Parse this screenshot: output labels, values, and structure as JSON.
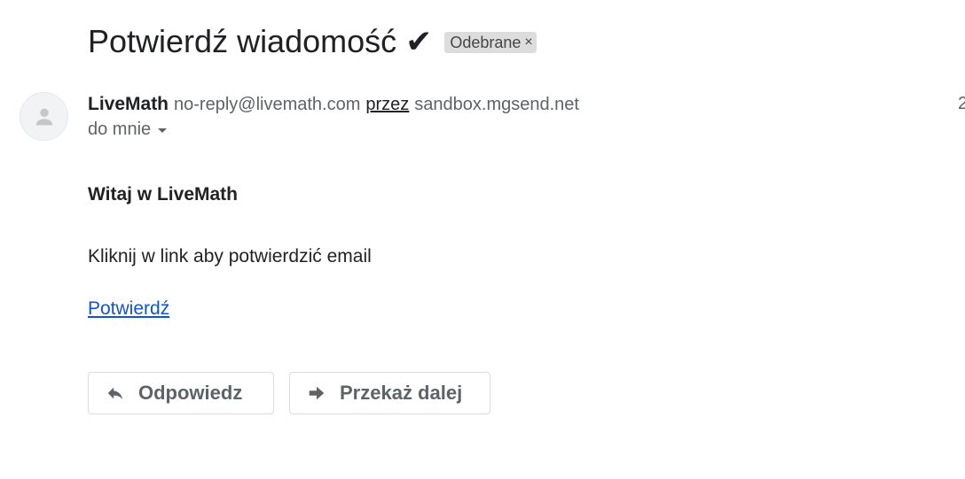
{
  "email": {
    "subject": "Potwierdź wiadomość ✔",
    "label": "Odebrane",
    "label_close": "×",
    "sender": {
      "name": "LiveMath",
      "email": "no-reply@livemath.com",
      "via_label": "przez",
      "via_domain": "sandbox.mgsend.net",
      "date_partial": "2"
    },
    "recipient": "do mnie",
    "body": {
      "greeting": "Witaj w LiveMath",
      "text": "Kliknij w link aby potwierdzić email",
      "link": "Potwierdź"
    }
  },
  "actions": {
    "reply_label": "Odpowiedz",
    "forward_label": "Przekaż dalej"
  },
  "icons": {
    "avatar": "person-icon",
    "reply": "reply-arrow-icon",
    "forward": "forward-arrow-icon",
    "recipient_details": "caret-down-icon"
  },
  "colors": {
    "link": "#1155cc",
    "label_chip": "#dddddd",
    "secondary_text": "#5f6368"
  }
}
